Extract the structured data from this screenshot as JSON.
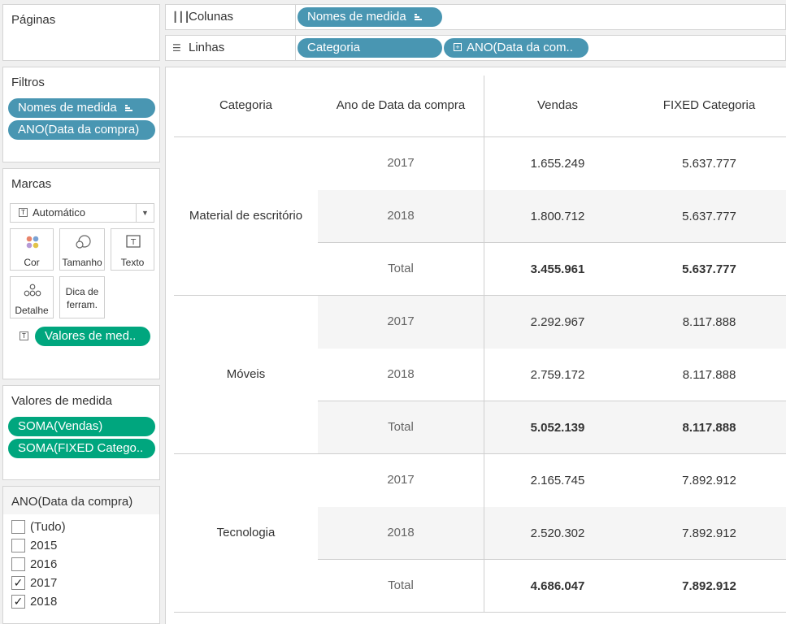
{
  "pages_panel": {
    "title": "Páginas"
  },
  "columns_shelf": {
    "label": "Colunas",
    "pill": "Nomes de medida"
  },
  "rows_shelf": {
    "label": "Linhas",
    "pills": [
      "Categoria",
      "ANO(Data da com.."
    ]
  },
  "filters": {
    "title": "Filtros",
    "pills": [
      "Nomes de medida",
      "ANO(Data da compra)"
    ]
  },
  "marks": {
    "title": "Marcas",
    "type_select": "Automático",
    "buttons": [
      "Cor",
      "Tamanho",
      "Texto",
      "Detalhe",
      "Dica de ferram."
    ],
    "text_pill": "Valores de med.."
  },
  "measure_values": {
    "title": "Valores de medida",
    "pills": [
      "SOMA(Vendas)",
      "SOMA(FIXED Catego.."
    ]
  },
  "year_filter": {
    "title": "ANO(Data da compra)",
    "options": [
      {
        "label": "(Tudo)",
        "checked": false
      },
      {
        "label": "2015",
        "checked": false
      },
      {
        "label": "2016",
        "checked": false
      },
      {
        "label": "2017",
        "checked": true
      },
      {
        "label": "2018",
        "checked": true
      }
    ]
  },
  "table": {
    "headers": [
      "Categoria",
      "Ano de Data da compra",
      "Vendas",
      "FIXED Categoria"
    ],
    "groups": [
      {
        "category": "Material de escritório",
        "rows": [
          {
            "year": "2017",
            "vendas": "1.655.249",
            "fixed": "5.637.777"
          },
          {
            "year": "2018",
            "vendas": "1.800.712",
            "fixed": "5.637.777"
          },
          {
            "year": "Total",
            "vendas": "3.455.961",
            "fixed": "5.637.777"
          }
        ]
      },
      {
        "category": "Móveis",
        "rows": [
          {
            "year": "2017",
            "vendas": "2.292.967",
            "fixed": "8.117.888"
          },
          {
            "year": "2018",
            "vendas": "2.759.172",
            "fixed": "8.117.888"
          },
          {
            "year": "Total",
            "vendas": "5.052.139",
            "fixed": "8.117.888"
          }
        ]
      },
      {
        "category": "Tecnologia",
        "rows": [
          {
            "year": "2017",
            "vendas": "2.165.745",
            "fixed": "7.892.912"
          },
          {
            "year": "2018",
            "vendas": "2.520.302",
            "fixed": "7.892.912"
          },
          {
            "year": "Total",
            "vendas": "4.686.047",
            "fixed": "7.892.912"
          }
        ]
      }
    ]
  },
  "colors": {
    "blue_pill": "#4996b2",
    "green_pill": "#00a67e",
    "band": "#f5f5f5"
  }
}
